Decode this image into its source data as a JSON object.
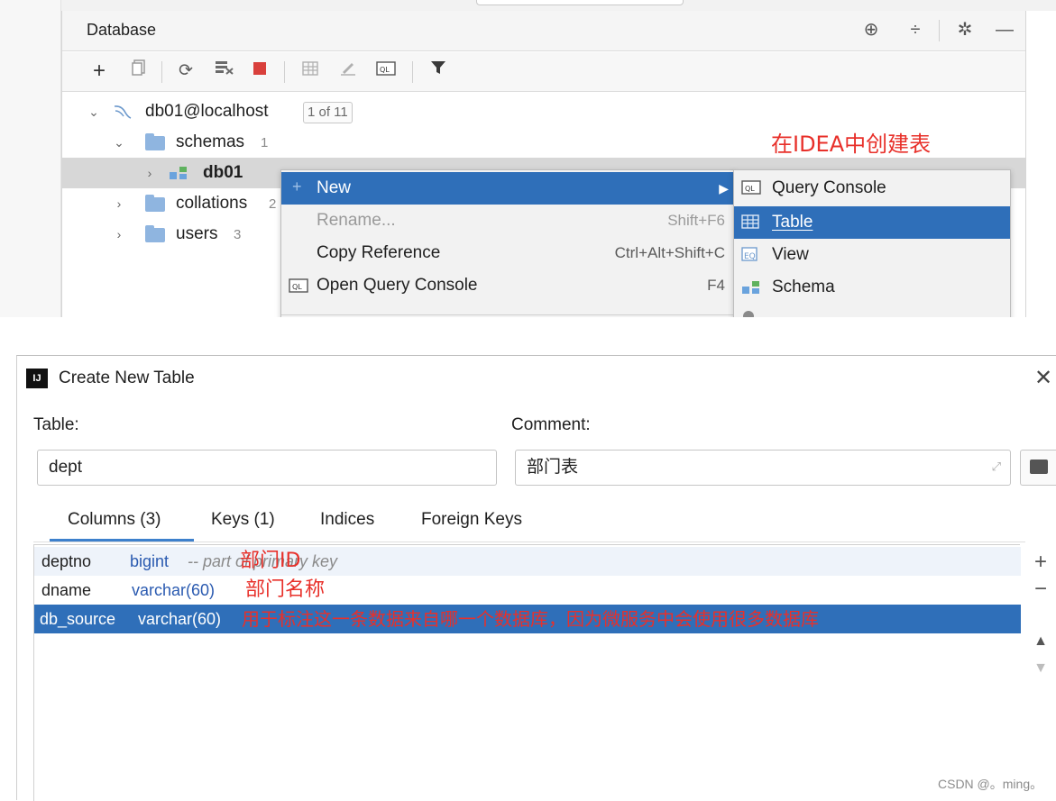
{
  "ide": {
    "panel_title": "Database",
    "header_icons": [
      "crosshair-icon",
      "collapse-icon",
      "gear-icon",
      "minimize-icon"
    ],
    "toolbar_icons": [
      "add-icon",
      "copy-icon",
      "refresh-icon",
      "manage-icon",
      "stop-icon",
      "table-icon",
      "edit-icon",
      "query-console-icon",
      "filter-icon"
    ],
    "tree": {
      "connection": "db01@localhost",
      "connection_badge": "1 of 11",
      "schemas_label": "schemas",
      "schemas_count": "1",
      "db_label": "db01",
      "collations_label": "collations",
      "collations_count": "2",
      "users_label": "users",
      "users_count": "3"
    },
    "annotation": "在IDEA中创建表",
    "context_menu": {
      "items": [
        {
          "label": "New",
          "shortcut": ""
        },
        {
          "label": "Rename...",
          "shortcut": "Shift+F6"
        },
        {
          "label": "Copy Reference",
          "shortcut": "Ctrl+Alt+Shift+C"
        },
        {
          "label": "Open Query Console",
          "shortcut": "F4"
        }
      ]
    },
    "submenu": {
      "items": [
        {
          "label": "Query Console"
        },
        {
          "label": "Table"
        },
        {
          "label": "View"
        },
        {
          "label": "Schema"
        }
      ]
    },
    "colors": {
      "selection": "#2f6fb9",
      "annotation": "#e8302a"
    }
  },
  "dialog": {
    "title": "Create New Table",
    "table_label": "Table:",
    "table_value": "dept",
    "comment_label": "Comment:",
    "comment_value": "部门表",
    "tabs": [
      "Columns (3)",
      "Keys (1)",
      "Indices",
      "Foreign Keys"
    ],
    "columns": [
      {
        "name": "deptno",
        "type": "bigint",
        "comment": "-- part of primary key",
        "annotation": "部门ID"
      },
      {
        "name": "dname",
        "type": "varchar(60)",
        "comment": "",
        "annotation": "部门名称"
      },
      {
        "name": "db_source",
        "type": "varchar(60)",
        "comment": "",
        "annotation": "用于标注这一条数据来自哪一个数据库，因为微服务中会使用很多数据库"
      }
    ],
    "side_buttons": [
      "add-icon",
      "remove-icon",
      "move-up-icon",
      "move-down-icon"
    ]
  },
  "watermark": "CSDN @。ming。"
}
